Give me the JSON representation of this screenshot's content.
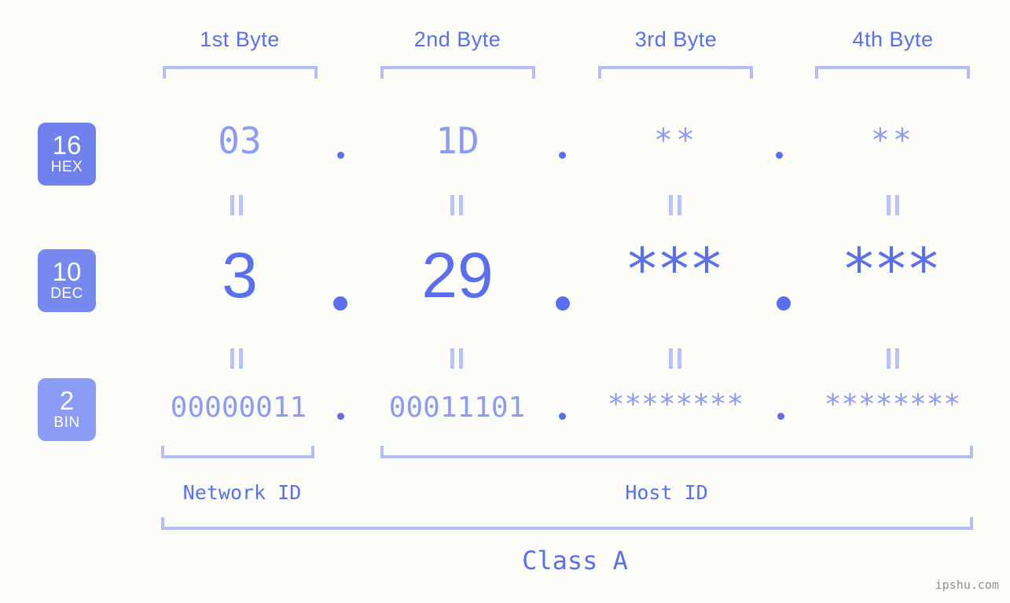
{
  "meta": {
    "background": "#fcfdf8",
    "accent": "#5a6ff0",
    "accent_light": "#8c9bf5",
    "bracket": "#b3bdf7",
    "badge_bg_hex": "#6f81ec",
    "badge_bg_dec": "#7689f0",
    "badge_bg_bin": "#8a9cf6",
    "watermark": "ipshu.com"
  },
  "byte_headers": [
    {
      "label": "1st Byte"
    },
    {
      "label": "2nd Byte"
    },
    {
      "label": "3rd Byte"
    },
    {
      "label": "4th Byte"
    }
  ],
  "bases": [
    {
      "number": "16",
      "name": "HEX"
    },
    {
      "number": "10",
      "name": "DEC"
    },
    {
      "number": "2",
      "name": "BIN"
    }
  ],
  "rows": {
    "hex": {
      "base_number": "16",
      "base_name": "HEX",
      "bytes": [
        "03",
        "1D",
        "**",
        "**"
      ],
      "separators": [
        ".",
        ".",
        "."
      ]
    },
    "dec": {
      "base_number": "10",
      "base_name": "DEC",
      "bytes": [
        "3",
        "29",
        "***",
        "***"
      ],
      "separators": [
        ".",
        ".",
        "."
      ]
    },
    "bin": {
      "base_number": "2",
      "base_name": "BIN",
      "bytes": [
        "00000011",
        "00011101",
        "********",
        "********"
      ],
      "separators": [
        ".",
        ".",
        "."
      ]
    }
  },
  "equals_marks": {
    "symbol": "=",
    "count_per_row_gap": 4,
    "row_gaps": 2
  },
  "sections": [
    {
      "label": "Network ID",
      "span_bytes": [
        1,
        1
      ]
    },
    {
      "label": "Host ID",
      "span_bytes": [
        2,
        4
      ]
    }
  ],
  "class": {
    "label": "Class A"
  },
  "address": {
    "dec": "3.29.***.***",
    "hex": "03.1D.**.**",
    "bin": "00000011.00011101.********.********"
  }
}
